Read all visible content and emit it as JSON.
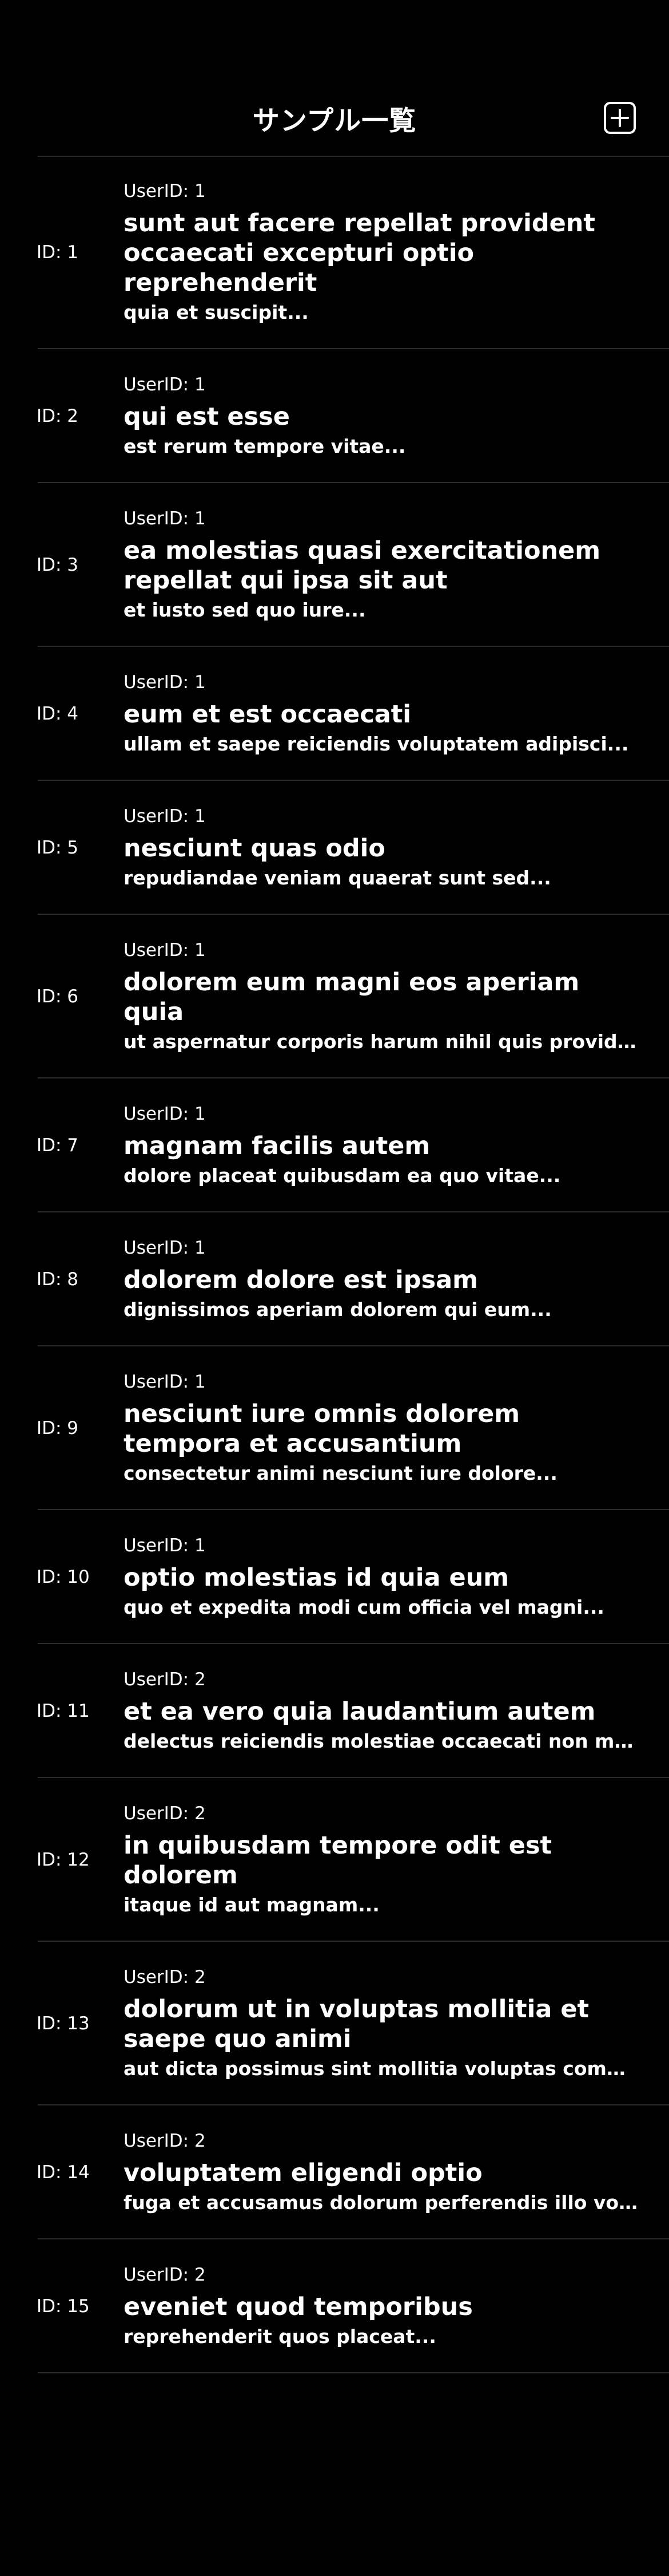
{
  "nav": {
    "title": "サンプル一覧",
    "add_icon": "plus-square-icon"
  },
  "posts": [
    {
      "id": "ID: 1",
      "user": "UserID: 1",
      "title": "sunt aut facere repellat provident occaecati excepturi optio reprehenderit",
      "body": "quia et suscipit..."
    },
    {
      "id": "ID: 2",
      "user": "UserID: 1",
      "title": "qui est esse",
      "body": "est rerum tempore vitae..."
    },
    {
      "id": "ID: 3",
      "user": "UserID: 1",
      "title": "ea molestias quasi exercitationem repellat qui ipsa sit aut",
      "body": "et iusto sed quo iure..."
    },
    {
      "id": "ID: 4",
      "user": "UserID: 1",
      "title": "eum et est occaecati",
      "body": "ullam et saepe reiciendis voluptatem adipisci..."
    },
    {
      "id": "ID: 5",
      "user": "UserID: 1",
      "title": "nesciunt quas odio",
      "body": "repudiandae veniam quaerat sunt sed..."
    },
    {
      "id": "ID: 6",
      "user": "UserID: 1",
      "title": "dolorem eum magni eos aperiam quia",
      "body": "ut aspernatur corporis harum nihil quis provident se..."
    },
    {
      "id": "ID: 7",
      "user": "UserID: 1",
      "title": "magnam facilis autem",
      "body": "dolore placeat quibusdam ea quo vitae..."
    },
    {
      "id": "ID: 8",
      "user": "UserID: 1",
      "title": "dolorem dolore est ipsam",
      "body": "dignissimos aperiam dolorem qui eum..."
    },
    {
      "id": "ID: 9",
      "user": "UserID: 1",
      "title": "nesciunt iure omnis dolorem tempora et accusantium",
      "body": "consectetur animi nesciunt iure dolore..."
    },
    {
      "id": "ID: 10",
      "user": "UserID: 1",
      "title": "optio molestias id quia eum",
      "body": "quo et expedita modi cum officia vel magni..."
    },
    {
      "id": "ID: 11",
      "user": "UserID: 2",
      "title": "et ea vero quia laudantium autem",
      "body": "delectus reiciendis molestiae occaecati non minima..."
    },
    {
      "id": "ID: 12",
      "user": "UserID: 2",
      "title": "in quibusdam tempore odit est dolorem",
      "body": "itaque id aut magnam..."
    },
    {
      "id": "ID: 13",
      "user": "UserID: 2",
      "title": "dolorum ut in voluptas mollitia et saepe quo animi",
      "body": "aut dicta possimus sint mollitia voluptas commodi q..."
    },
    {
      "id": "ID: 14",
      "user": "UserID: 2",
      "title": "voluptatem eligendi optio",
      "body": "fuga et accusamus dolorum perferendis illo volupt..."
    },
    {
      "id": "ID: 15",
      "user": "UserID: 2",
      "title": "eveniet quod temporibus",
      "body": "reprehenderit quos placeat..."
    }
  ],
  "colors": {
    "background": "#000000",
    "text": "#ffffff",
    "separator": "#2c2c2e"
  }
}
